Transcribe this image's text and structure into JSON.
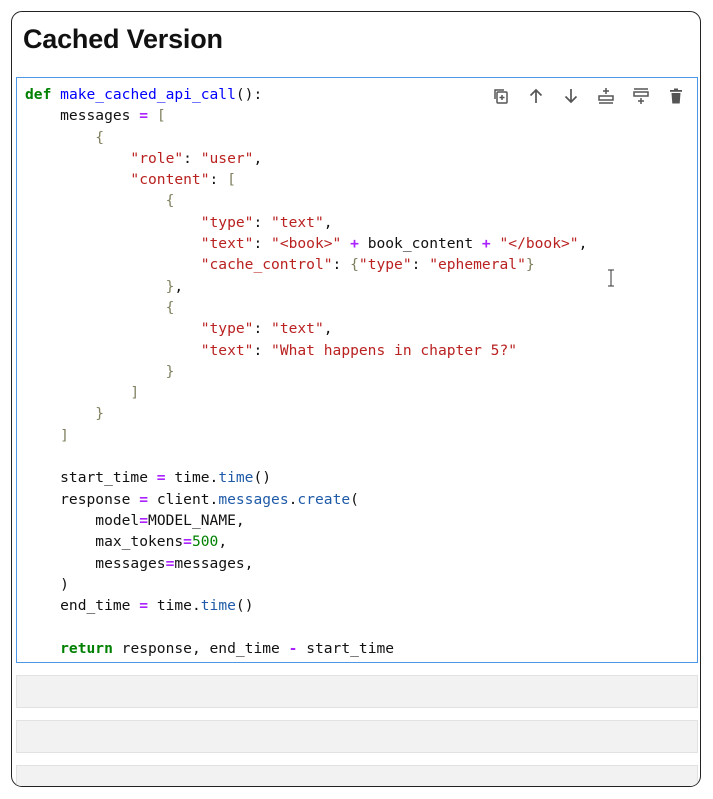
{
  "section": {
    "title": "Cached Version"
  },
  "code_cell": {
    "lines": [
      [
        [
          "kw",
          "def"
        ],
        [
          "",
          "&nbsp;"
        ],
        [
          "fn",
          "make_cached_api_call"
        ],
        [
          "",
          "():"
        ]
      ],
      [
        [
          "",
          "    messages "
        ],
        [
          "op",
          "="
        ],
        [
          "br",
          " ["
        ]
      ],
      [
        [
          "br",
          "        {"
        ]
      ],
      [
        [
          "st",
          "            \"role\""
        ],
        [
          "",
          ": "
        ],
        [
          "st",
          "\"user\""
        ],
        [
          "",
          ","
        ]
      ],
      [
        [
          "st",
          "            \"content\""
        ],
        [
          "",
          ": "
        ],
        [
          "br",
          "["
        ]
      ],
      [
        [
          "br",
          "                {"
        ]
      ],
      [
        [
          "st",
          "                    \"type\""
        ],
        [
          "",
          ": "
        ],
        [
          "st",
          "\"text\""
        ],
        [
          "",
          ","
        ]
      ],
      [
        [
          "st",
          "                    \"text\""
        ],
        [
          "",
          ": "
        ],
        [
          "st",
          "\"<book>\""
        ],
        [
          "op",
          " +"
        ],
        [
          "",
          " book_content "
        ],
        [
          "op",
          "+"
        ],
        [
          "st",
          " \"</book>\""
        ],
        [
          "",
          ","
        ]
      ],
      [
        [
          "st",
          "                    \"cache_control\""
        ],
        [
          "",
          ": "
        ],
        [
          "br",
          "{"
        ],
        [
          "st",
          "\"type\""
        ],
        [
          "",
          ": "
        ],
        [
          "st",
          "\"ephemeral\""
        ],
        [
          "br",
          "}"
        ]
      ],
      [
        [
          "br",
          "                }"
        ],
        [
          "",
          ","
        ]
      ],
      [
        [
          "br",
          "                {"
        ]
      ],
      [
        [
          "st",
          "                    \"type\""
        ],
        [
          "",
          ": "
        ],
        [
          "st",
          "\"text\""
        ],
        [
          "",
          ","
        ]
      ],
      [
        [
          "st",
          "                    \"text\""
        ],
        [
          "",
          ": "
        ],
        [
          "st",
          "\"What happens in chapter 5?\""
        ]
      ],
      [
        [
          "br",
          "                }"
        ]
      ],
      [
        [
          "br",
          "            ]"
        ]
      ],
      [
        [
          "br",
          "        }"
        ]
      ],
      [
        [
          "br",
          "    ]"
        ]
      ],
      [
        [
          "",
          ""
        ]
      ],
      [
        [
          "",
          "    start_time "
        ],
        [
          "op",
          "="
        ],
        [
          "",
          " time."
        ],
        [
          "at",
          "time"
        ],
        [
          "",
          "()"
        ]
      ],
      [
        [
          "",
          "    response "
        ],
        [
          "op",
          "="
        ],
        [
          "",
          " client."
        ],
        [
          "at",
          "messages"
        ],
        [
          "",
          "."
        ],
        [
          "at",
          "create"
        ],
        [
          "",
          "("
        ]
      ],
      [
        [
          "",
          "        model"
        ],
        [
          "op",
          "="
        ],
        [
          "",
          "MODEL_NAME,"
        ]
      ],
      [
        [
          "",
          "        max_tokens"
        ],
        [
          "op",
          "="
        ],
        [
          "nm",
          "500"
        ],
        [
          "",
          ","
        ]
      ],
      [
        [
          "",
          "        messages"
        ],
        [
          "op",
          "="
        ],
        [
          "",
          "messages,"
        ]
      ],
      [
        [
          "",
          "    )"
        ]
      ],
      [
        [
          "",
          "    end_time "
        ],
        [
          "op",
          "="
        ],
        [
          "",
          " time."
        ],
        [
          "at",
          "time"
        ],
        [
          "",
          "()"
        ]
      ],
      [
        [
          "",
          ""
        ]
      ],
      [
        [
          "kw",
          "    return"
        ],
        [
          "",
          " response, end_time "
        ],
        [
          "op",
          "-"
        ],
        [
          "",
          " start_time"
        ]
      ]
    ]
  },
  "toolbar": {
    "buttons": [
      {
        "name": "duplicate-icon"
      },
      {
        "name": "move-up-icon"
      },
      {
        "name": "move-down-icon"
      },
      {
        "name": "insert-above-icon"
      },
      {
        "name": "insert-below-icon"
      },
      {
        "name": "delete-icon"
      }
    ]
  },
  "colors": {
    "keyword": "#008000",
    "function": "#0000ff",
    "string": "#ba2121",
    "operator": "#aa22ff",
    "cell_border": "#4d97e6",
    "empty_cell": "#f1f2f1"
  }
}
